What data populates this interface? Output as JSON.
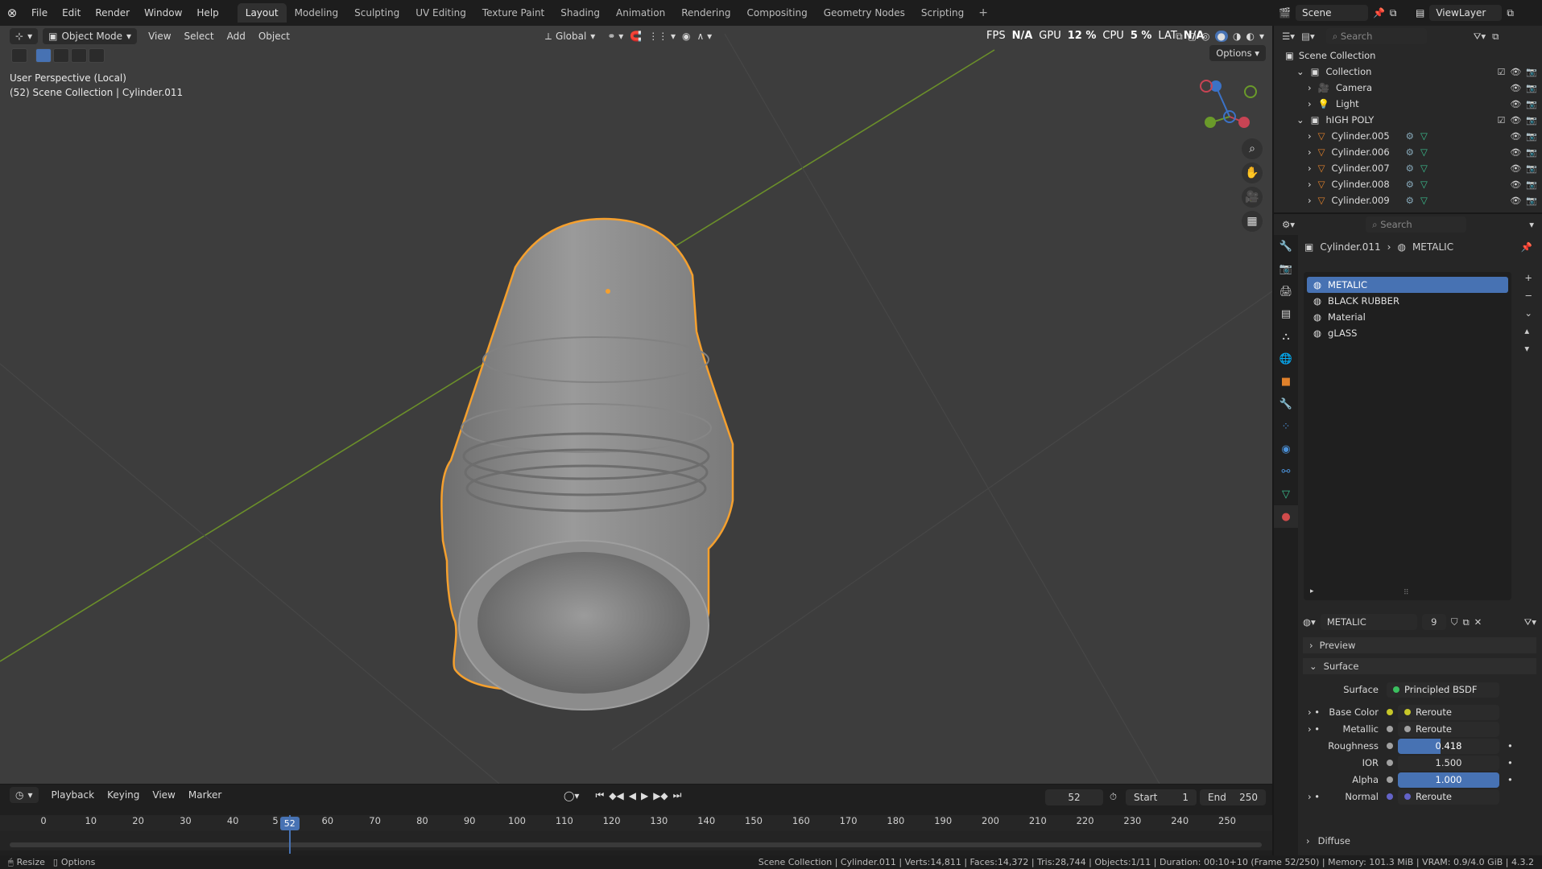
{
  "topbar": {
    "menus": [
      "File",
      "Edit",
      "Render",
      "Window",
      "Help"
    ],
    "workspaces": [
      "Layout",
      "Modeling",
      "Sculpting",
      "UV Editing",
      "Texture Paint",
      "Shading",
      "Animation",
      "Rendering",
      "Compositing",
      "Geometry Nodes",
      "Scripting"
    ],
    "active_workspace": "Layout",
    "scene": "Scene",
    "view_layer": "ViewLayer"
  },
  "viewport": {
    "mode": "Object Mode",
    "menus": [
      "View",
      "Select",
      "Add",
      "Object"
    ],
    "orientation": "Global",
    "options_label": "Options",
    "perspective_label": "User Perspective (Local)",
    "collection_label": "(52) Scene Collection | Cylinder.011",
    "stats": {
      "fps": "FPS",
      "fps_val": "N/A",
      "gpu": "GPU",
      "gpu_val": "12 %",
      "cpu": "CPU",
      "cpu_val": "5 %",
      "lat": "LAT",
      "lat_val": "N/A"
    },
    "gizmo_axes": {
      "z": "Z",
      "y": "Y",
      "x": "X"
    }
  },
  "outliner": {
    "search_placeholder": "Search",
    "root": "Scene Collection",
    "rows": [
      {
        "label": "Collection",
        "indent": 1,
        "type": "collection"
      },
      {
        "label": "Camera",
        "indent": 2,
        "type": "camera"
      },
      {
        "label": "Light",
        "indent": 2,
        "type": "light"
      },
      {
        "label": "hIGH POLY",
        "indent": 1,
        "type": "collection"
      },
      {
        "label": "Cylinder.005",
        "indent": 2,
        "type": "mesh"
      },
      {
        "label": "Cylinder.006",
        "indent": 2,
        "type": "mesh"
      },
      {
        "label": "Cylinder.007",
        "indent": 2,
        "type": "mesh"
      },
      {
        "label": "Cylinder.008",
        "indent": 2,
        "type": "mesh"
      },
      {
        "label": "Cylinder.009",
        "indent": 2,
        "type": "mesh"
      }
    ]
  },
  "properties": {
    "search_placeholder": "Search",
    "breadcrumb_object": "Cylinder.011",
    "breadcrumb_material": "METALIC",
    "materials": [
      "METALIC",
      "BLACK RUBBER",
      "Material",
      "gLASS"
    ],
    "selected_material": "METALIC",
    "material_name": "METALIC",
    "user_count": "9",
    "preview_label": "Preview",
    "surface_section": "Surface",
    "surface_label": "Surface",
    "surface_value": "Principled BSDF",
    "inputs": [
      {
        "label": "Base Color",
        "value": "Reroute",
        "kind": "link",
        "dot": "#c7c729"
      },
      {
        "label": "Metallic",
        "value": "Reroute",
        "kind": "link",
        "dot": "#a1a1a1"
      },
      {
        "label": "Roughness",
        "value": "0.418",
        "kind": "slider",
        "fraction": 0.418,
        "dot": "#a1a1a1"
      },
      {
        "label": "IOR",
        "value": "1.500",
        "kind": "field",
        "dot": "#a1a1a1"
      },
      {
        "label": "Alpha",
        "value": "1.000",
        "kind": "slider",
        "fraction": 1.0,
        "dot": "#a1a1a1"
      },
      {
        "label": "Normal",
        "value": "Reroute",
        "kind": "link",
        "dot": "#6363c7"
      }
    ],
    "diffuse_label": "Diffuse"
  },
  "timeline": {
    "menus": [
      "Playback",
      "Keying",
      "View",
      "Marker"
    ],
    "current_frame": "52",
    "start_label": "Start",
    "start": "1",
    "end_label": "End",
    "end": "250",
    "ticks": [
      "0",
      "10",
      "20",
      "30",
      "40",
      "5",
      "60",
      "70",
      "80",
      "90",
      "100",
      "110",
      "120",
      "130",
      "140",
      "150",
      "160",
      "170",
      "180",
      "190",
      "200",
      "210",
      "220",
      "230",
      "240",
      "250"
    ],
    "cursor_label": "52"
  },
  "statusbar": {
    "left_items": [
      "Resize",
      "Options"
    ],
    "info": "Scene Collection | Cylinder.011 | Verts:14,811 | Faces:14,372 | Tris:28,744 | Objects:1/11 | Duration: 00:10+10 (Frame 52/250) | Memory: 101.3 MiB | VRAM: 0.9/4.0 GiB | 4.3.2"
  },
  "colors": {
    "accent": "#4772b3",
    "selection": "#f5a02e",
    "mesh": "#e0812b",
    "x_axis": "#c84454",
    "y_axis": "#6a9a2a",
    "z_axis": "#3b72c7"
  }
}
